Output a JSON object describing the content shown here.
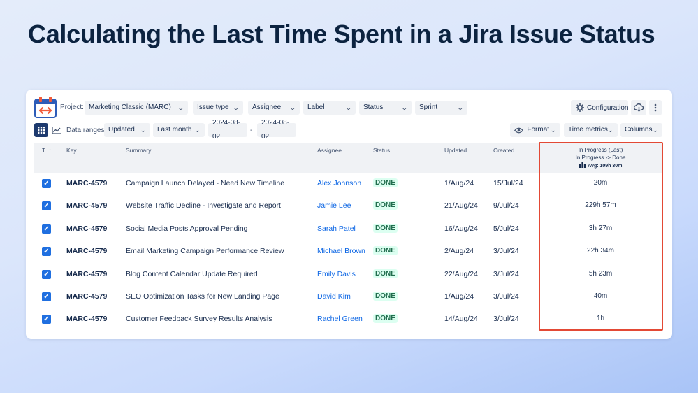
{
  "slide": {
    "title": "Calculating the Last Time Spent in a Jira Issue Status"
  },
  "toolbar": {
    "project_label": "Project:",
    "project_value": "Marketing Classic (MARC)",
    "filters": [
      "Issue type",
      "Assignee",
      "Label",
      "Status",
      "Sprint"
    ],
    "configuration_label": "Configuration",
    "data_ranges_label": "Data ranges:",
    "data_range_field": "Updated",
    "data_range_period": "Last month",
    "date_from": "2024-08-02",
    "date_separator": "-",
    "date_to": "2024-08-02",
    "format_label": "Format",
    "time_metrics_label": "Time metrics",
    "columns_label": "Columns"
  },
  "table": {
    "headers": {
      "type": "T",
      "sort_arrow": "↑",
      "key": "Key",
      "summary": "Summary",
      "assignee": "Assignee",
      "status": "Status",
      "updated": "Updated",
      "created": "Created",
      "metric_title": "In Progress (Last)",
      "metric_subtitle": "In Progress -> Done",
      "metric_avg": "Avg: 109h 30m"
    },
    "rows": [
      {
        "key": "MARC-4579",
        "summary": "Campaign Launch Delayed - Need New Timeline",
        "assignee": "Alex Johnson",
        "status": "DONE",
        "updated": "1/Aug/24",
        "created": "15/Jul/24",
        "metric": "20m"
      },
      {
        "key": "MARC-4579",
        "summary": "Website Traffic Decline - Investigate and Report",
        "assignee": "Jamie Lee",
        "status": "DONE",
        "updated": "21/Aug/24",
        "created": "9/Jul/24",
        "metric": "229h 57m"
      },
      {
        "key": "MARC-4579",
        "summary": "Social Media Posts Approval Pending",
        "assignee": "Sarah Patel",
        "status": "DONE",
        "updated": "16/Aug/24",
        "created": "5/Jul/24",
        "metric": "3h 27m"
      },
      {
        "key": "MARC-4579",
        "summary": "Email Marketing Campaign Performance Review",
        "assignee": "Michael Brown",
        "status": "DONE",
        "updated": "2/Aug/24",
        "created": "3/Jul/24",
        "metric": "22h 34m"
      },
      {
        "key": "MARC-4579",
        "summary": "Blog Content Calendar Update Required",
        "assignee": "Emily Davis",
        "status": "DONE",
        "updated": "22/Aug/24",
        "created": "3/Jul/24",
        "metric": "5h 23m"
      },
      {
        "key": "MARC-4579",
        "summary": "SEO Optimization Tasks for New Landing Page",
        "assignee": "David Kim",
        "status": "DONE",
        "updated": "1/Aug/24",
        "created": "3/Jul/24",
        "metric": "40m"
      },
      {
        "key": "MARC-4579",
        "summary": "Customer Feedback Survey Results Analysis",
        "assignee": "Rachel Green",
        "status": "DONE",
        "updated": "14/Aug/24",
        "created": "3/Jul/24",
        "metric": "1h"
      }
    ]
  },
  "colors": {
    "accent": "#1f6fe0",
    "highlight": "#e34935",
    "done_bg": "#dcfff1",
    "done_text": "#216e4e"
  },
  "icons": [
    "calendar-app-icon",
    "gear-icon",
    "cloud-download-icon",
    "more-vertical-icon",
    "grid-view-icon",
    "chart-view-icon",
    "eye-icon",
    "chevron-down-icon",
    "checkbox-icon",
    "stopwatch-icon"
  ]
}
